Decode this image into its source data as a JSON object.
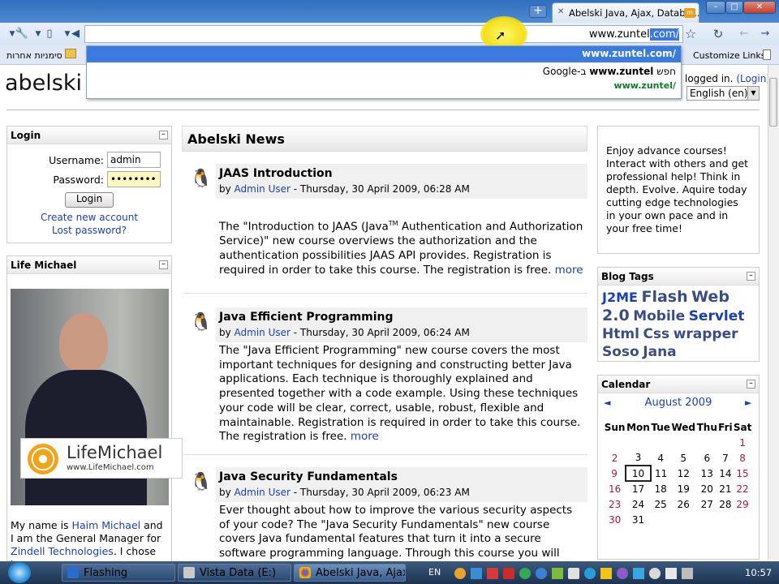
{
  "browser": {
    "tab_title": "Abelski Java, Ajax, Databa...",
    "tab_favicon": "m",
    "new_tab": "+",
    "window_buttons": [
      "–",
      "□",
      "✕"
    ],
    "omnibox_text": "www.zuntel",
    "omnibox_selected": ".com/",
    "suggestions": [
      {
        "text": "www.zuntel.com/"
      },
      {
        "prefix": "Google-ב ",
        "bold": "www.zuntel",
        "suffix": " חפש"
      },
      {
        "text": "www.zuntel/"
      }
    ],
    "bookmark_folder": "סימניות אחרות",
    "bookmark_right": "Customize Links"
  },
  "page": {
    "logo": "abelski",
    "login_status": "logged in.",
    "login_link": "(Login)",
    "language": "English (en)",
    "login_block": {
      "title": "Login",
      "username_label": "Username:",
      "username_value": "admin",
      "password_label": "Password:",
      "password_value": "••••••••",
      "button": "Login",
      "create_account": "Create new account",
      "lost_password": "Lost password?"
    },
    "life_block": {
      "title": "Life Michael",
      "brand": "LifeMichael",
      "brand_url": "www.LifeMichael.com",
      "text_1": "My name is ",
      "link_1": "Haim Michael",
      "text_2": " and I am the General Manager for ",
      "link_2": "Zindell Technologies",
      "text_3": ". I chose to"
    },
    "news_title": "Abelski News",
    "news": [
      {
        "title": "JAAS Introduction",
        "author": "Admin User",
        "date": " - Thursday, 30 April 2009, 06:28 AM",
        "body_1": "The \"Introduction to JAAS (Java",
        "tm": "TM",
        "body_2": " Authentication and Authorization Service)\" new course overviews the authorization and the authentication possibilities JAAS API provides. Registration is required in order to take this course. The registration is free. ",
        "more": "more"
      },
      {
        "title": "Java Efficient Programming",
        "author": "Admin User",
        "date": " - Thursday, 30 April 2009, 06:24 AM",
        "body": "The \"Java Efficient Programming\" new course covers the most important techniques for designing and constructing better Java applications. Each technique is thoroughly explained and presented together with a code example. Using these techniques your code will be clear, correct, usable, robust, flexible and maintainable. Registration is required in order to take this course. The registration is free. ",
        "more": "more"
      },
      {
        "title": "Java Security Fundamentals",
        "author": "Admin User",
        "date": " - Thursday, 30 April 2009, 06:23 AM",
        "body": "Ever thought about how to improve the various security aspects of your code? The \"Java Security Fundamentals\" new course covers Java fundamental features that turn it into a secure software programming language. Through this course you will become familiar"
      }
    ],
    "promo": "Enjoy advance courses! Interact with others and get professional help! Think in depth. Evolve. Aquire today cutting edge technologies in your own pace and in your free time!",
    "blog_tags_title": "Blog Tags",
    "tags": [
      "J2ME",
      "Flash",
      "Web 2.0",
      "Mobile",
      "Servlet",
      "Html",
      "Css",
      "wrapper",
      "Soso",
      "Jana"
    ],
    "calendar": {
      "title": "Calendar",
      "month": "August 2009",
      "prev": "◄",
      "next": "►",
      "days": [
        "Sun",
        "Mon",
        "Tue",
        "Wed",
        "Thu",
        "Fri",
        "Sat"
      ],
      "weeks": [
        [
          "",
          "",
          "",
          "",
          "",
          "",
          "1"
        ],
        [
          "2",
          "3",
          "4",
          "5",
          "6",
          "7",
          "8"
        ],
        [
          "9",
          "10",
          "11",
          "12",
          "13",
          "14",
          "15"
        ],
        [
          "16",
          "17",
          "18",
          "19",
          "20",
          "21",
          "22"
        ],
        [
          "23",
          "24",
          "25",
          "26",
          "27",
          "28",
          "29"
        ],
        [
          "30",
          "31",
          "",
          "",
          "",
          "",
          ""
        ]
      ],
      "today": "10"
    }
  },
  "taskbar": {
    "tasks": [
      "Flashing",
      "Vista Data (E:)",
      "Abelski Java, Ajax, ..."
    ],
    "lang": "EN",
    "clock": "10:57"
  },
  "colors": {
    "accent": "#1b3fb5",
    "tag": "#3a4d86",
    "weekend": "#b0163a"
  }
}
